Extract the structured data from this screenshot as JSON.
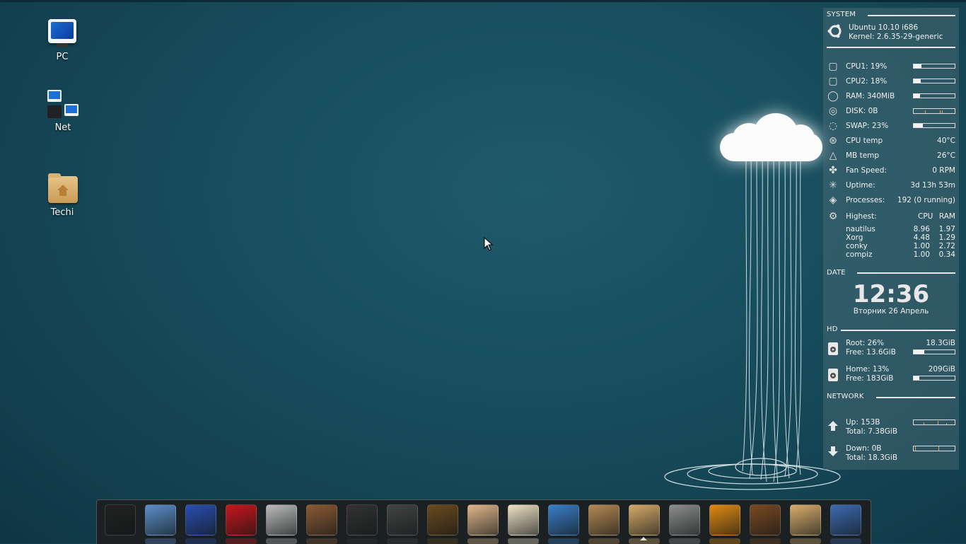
{
  "desktop": {
    "icons": [
      {
        "label": "PC"
      },
      {
        "label": "Net"
      },
      {
        "label": "Techi"
      }
    ]
  },
  "conky": {
    "system": {
      "header": "SYSTEM",
      "os": "Ubuntu 10.10 i686",
      "kernel": "Kernel: 2.6.35-29-generic",
      "rows": [
        {
          "label": "CPU1: 19%",
          "percent": 19,
          "type": "bar",
          "icon": "cpu-icon"
        },
        {
          "label": "CPU2: 18%",
          "percent": 18,
          "type": "bar",
          "icon": "cpu-icon"
        },
        {
          "label": "RAM: 340MiB",
          "percent": 15,
          "type": "bar",
          "icon": "ram-icon"
        },
        {
          "label": "DISK: 0B",
          "type": "graph",
          "icon": "disk-icon"
        },
        {
          "label": "SWAP: 23%",
          "percent": 23,
          "type": "bar",
          "icon": "swap-icon"
        },
        {
          "label": "CPU temp",
          "value": "40°C",
          "icon": "cpu-temp-icon"
        },
        {
          "label": "MB temp",
          "value": "26°C",
          "icon": "mb-temp-icon"
        },
        {
          "label": "Fan Speed:",
          "value": "0 RPM",
          "icon": "fan-icon"
        },
        {
          "label": "Uptime:",
          "value": "3d 13h 53m",
          "icon": "uptime-icon"
        },
        {
          "label": "Processes:",
          "value": "192 (0 running)",
          "icon": "processes-icon"
        }
      ],
      "highest": {
        "label": "Highest:",
        "cpu_header": "CPU",
        "ram_header": "RAM",
        "procs": [
          {
            "name": "nautilus",
            "cpu": "8.96",
            "ram": "1.97"
          },
          {
            "name": "Xorg",
            "cpu": "4.48",
            "ram": "1.29"
          },
          {
            "name": "conky",
            "cpu": "1.00",
            "ram": "2.72"
          },
          {
            "name": "compiz",
            "cpu": "1.00",
            "ram": "0.34"
          }
        ]
      }
    },
    "date": {
      "header": "DATE",
      "time": "12:36",
      "date_text": "Вторник 26 Апрель"
    },
    "hd": {
      "header": "HD",
      "drives": [
        {
          "line1": "Root: 26%",
          "size": "18.3GiB",
          "line2": "Free: 13.6GiB",
          "percent": 26
        },
        {
          "line1": "Home: 13%",
          "size": "209GiB",
          "line2": "Free: 183GiB",
          "percent": 13
        }
      ]
    },
    "network": {
      "header": "NETWORK",
      "up": {
        "line1": "Up: 153B",
        "line2": "Total: 7.38GiB"
      },
      "down": {
        "line1": "Down: 0B",
        "line2": "Total: 18.3GiB"
      }
    }
  },
  "dock": {
    "items": [
      {
        "name": "terminal-icon",
        "color": "#222"
      },
      {
        "name": "chromium-icon",
        "color": "#5b8fc9"
      },
      {
        "name": "browser-globe-icon",
        "color": "#2a4fb0"
      },
      {
        "name": "filezilla-icon",
        "color": "#c8161d"
      },
      {
        "name": "transmission-icon",
        "color": "#bbb"
      },
      {
        "name": "speaker-icon",
        "color": "#8a5a33"
      },
      {
        "name": "vlc-icon",
        "color": "#333"
      },
      {
        "name": "movie-player-icon",
        "color": "#444"
      },
      {
        "name": "mona-lisa-image-viewer-icon",
        "color": "#6b4a1e"
      },
      {
        "name": "paint-palette-icon",
        "color": "#e0b68a"
      },
      {
        "name": "mail-letter-icon",
        "color": "#efe2c4"
      },
      {
        "name": "chat-bubble-icon",
        "color": "#3a7ec8"
      },
      {
        "name": "package-box-icon",
        "color": "#b58a55"
      },
      {
        "name": "home-folder-icon",
        "color": "#d5aa69"
      },
      {
        "name": "trash-icon",
        "color": "#8d8d8d"
      },
      {
        "name": "compass-safari-icon",
        "color": "#e08a12"
      },
      {
        "name": "moose-icon",
        "color": "#7a4a22"
      },
      {
        "name": "folder-icon",
        "color": "#d8ad6c"
      },
      {
        "name": "text-editor-icon",
        "color": "#3c6bb0"
      }
    ]
  }
}
